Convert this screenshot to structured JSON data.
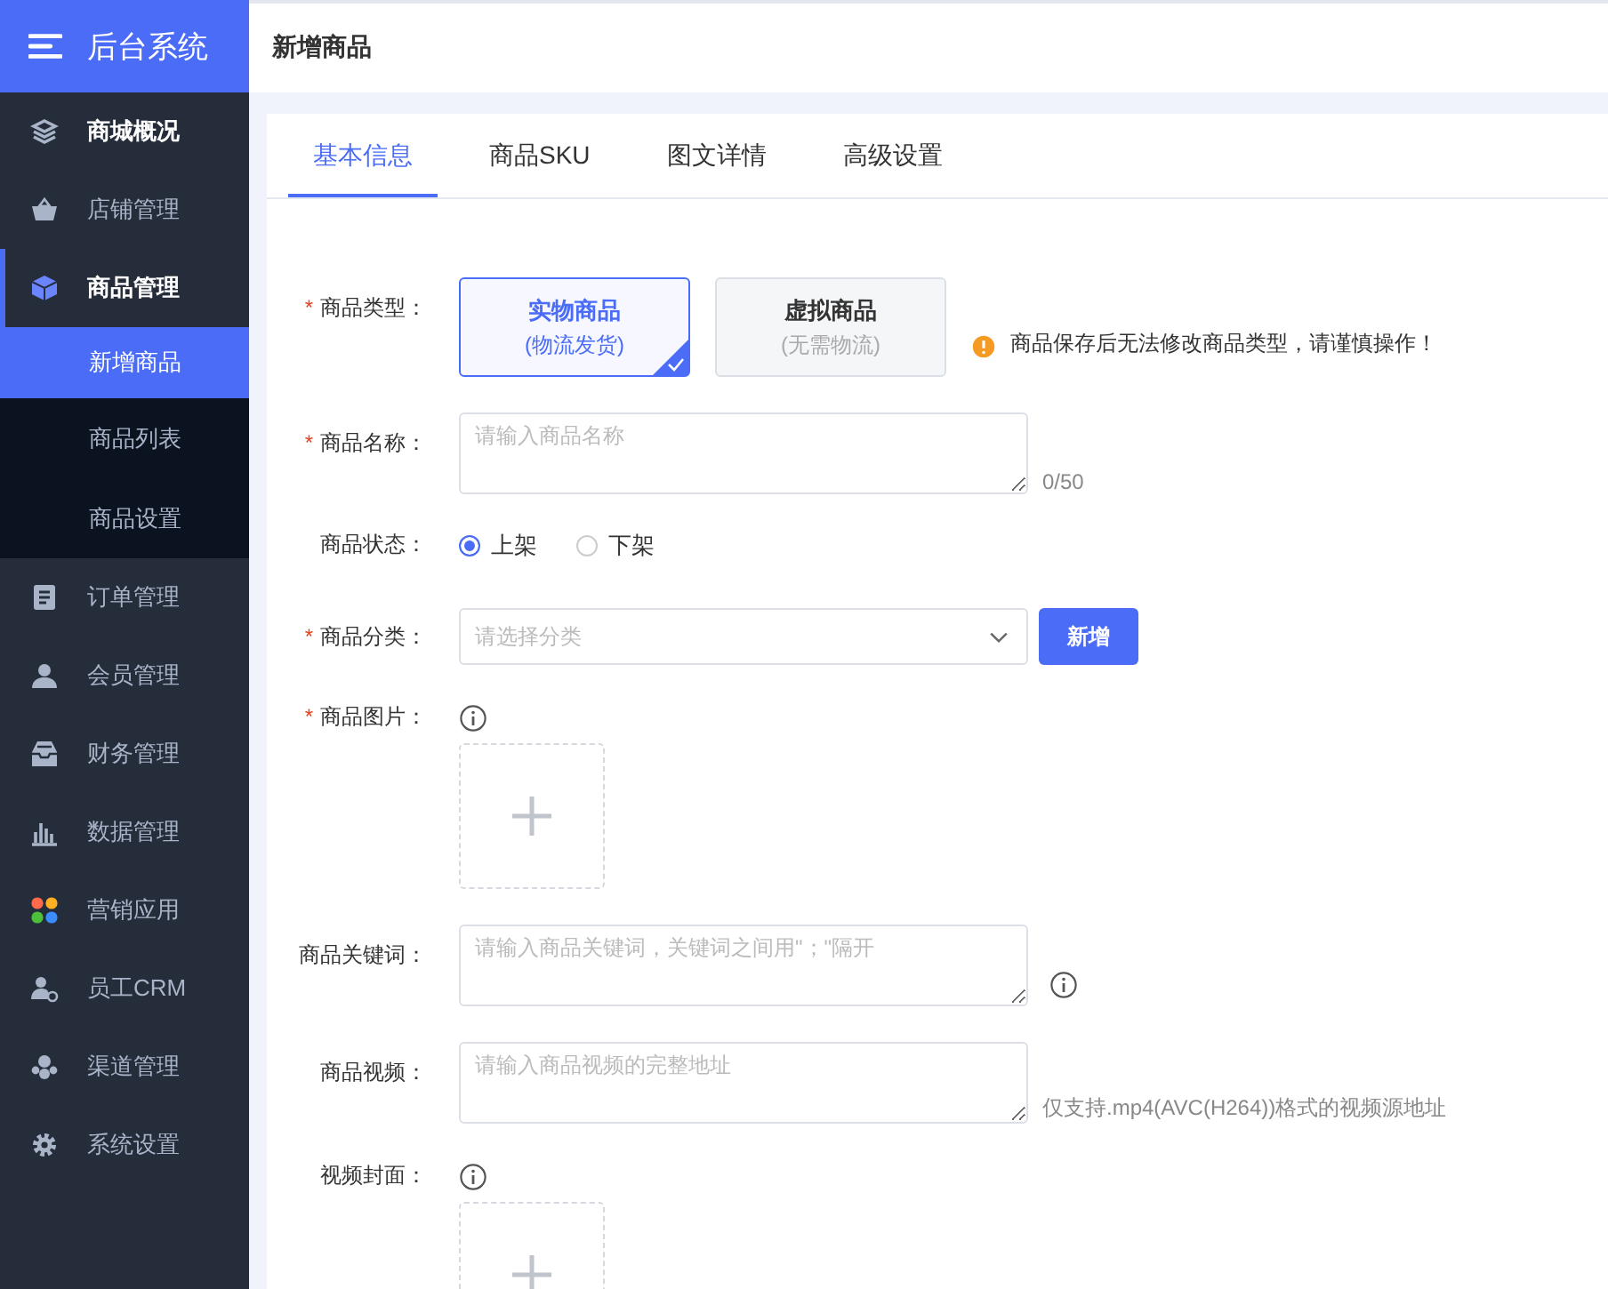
{
  "brand": {
    "title": "后台系统"
  },
  "header": {
    "title": "新增商品"
  },
  "sidebar": {
    "items": [
      {
        "label": "商城概况",
        "highlighted": true,
        "selected": false
      },
      {
        "label": "店铺管理",
        "highlighted": false,
        "selected": false
      },
      {
        "label": "商品管理",
        "highlighted": true,
        "selected": true,
        "expanded": true,
        "children": [
          {
            "label": "新增商品",
            "selected": true
          },
          {
            "label": "商品列表",
            "selected": false
          },
          {
            "label": "商品设置",
            "selected": false
          }
        ]
      },
      {
        "label": "订单管理",
        "highlighted": false,
        "selected": false
      },
      {
        "label": "会员管理",
        "highlighted": false,
        "selected": false
      },
      {
        "label": "财务管理",
        "highlighted": false,
        "selected": false
      },
      {
        "label": "数据管理",
        "highlighted": false,
        "selected": false
      },
      {
        "label": "营销应用",
        "highlighted": false,
        "selected": false
      },
      {
        "label": "员工CRM",
        "highlighted": false,
        "selected": false
      },
      {
        "label": "渠道管理",
        "highlighted": false,
        "selected": false
      },
      {
        "label": "系统设置",
        "highlighted": false,
        "selected": false
      }
    ]
  },
  "tabs": [
    {
      "label": "基本信息",
      "selected": true
    },
    {
      "label": "商品SKU",
      "selected": false
    },
    {
      "label": "图文详情",
      "selected": false
    },
    {
      "label": "高级设置",
      "selected": false
    }
  ],
  "form": [
    {
      "kind": "cards",
      "label": "商品类型：",
      "required_mark": "*",
      "options": [
        {
          "title": "实物商品",
          "subtitle": "(物流发货)",
          "selected": true
        },
        {
          "title": "虚拟商品",
          "subtitle": "(无需物流)",
          "selected": false
        }
      ],
      "warning": "商品保存后无法修改商品类型，请谨慎操作！"
    },
    {
      "kind": "textarea",
      "label": "商品名称：",
      "required_mark": "*",
      "placeholder": "请输入商品名称",
      "counter": "0/50"
    },
    {
      "kind": "radio",
      "label": "商品状态：",
      "options": [
        {
          "label": "上架",
          "selected": true
        },
        {
          "label": "下架",
          "selected": false
        }
      ]
    },
    {
      "kind": "select",
      "label": "商品分类：",
      "required_mark": "*",
      "placeholder": "请选择分类",
      "button": "新增"
    },
    {
      "kind": "upload",
      "label": "商品图片：",
      "required_mark": "*",
      "info": true
    },
    {
      "kind": "textarea",
      "label": "商品关键词：",
      "placeholder": "请输入商品关键词，关键词之间用\"；\"隔开",
      "info": true
    },
    {
      "kind": "textarea",
      "label": "商品视频：",
      "placeholder": "请输入商品视频的完整地址",
      "hint": "仅支持.mp4(AVC(H264))格式的视频源地址"
    },
    {
      "kind": "upload",
      "label": "视频封面：",
      "info": true
    }
  ]
}
